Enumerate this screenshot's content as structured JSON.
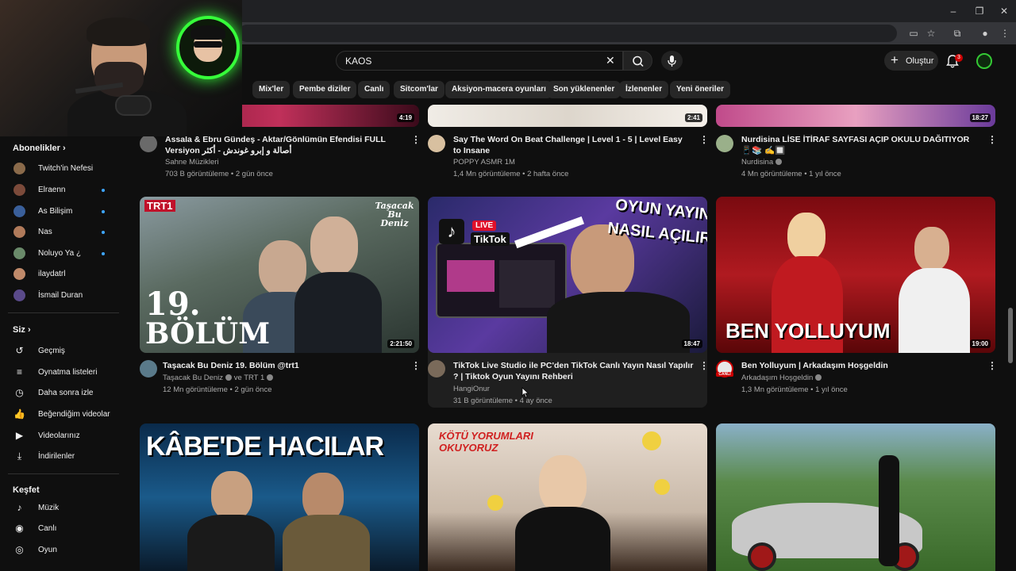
{
  "browser": {
    "window_controls": [
      "–",
      "❐",
      "✕"
    ]
  },
  "search": {
    "query": "KAOS"
  },
  "header": {
    "create_label": "Oluştur",
    "notification_count": "3"
  },
  "chips": [
    "Mix'ler",
    "Pembe diziler",
    "Canlı",
    "Sitcom'lar",
    "Aksiyon-macera oyunları",
    "Son yüklenenler",
    "İzlenenler",
    "Yeni öneriler"
  ],
  "sidebar": {
    "subscriptions_title": "Abonelikler",
    "subscriptions": [
      {
        "label": "Twitch'in Nefesi",
        "color": "#8a6a4a",
        "live": false
      },
      {
        "label": "Elraenn",
        "color": "#7b4a3a",
        "live": true
      },
      {
        "label": "As Bilişim",
        "color": "#3a5f9a",
        "live": true
      },
      {
        "label": "Nas",
        "color": "#b07a5a",
        "live": true
      },
      {
        "label": "Noluyo Ya ¿",
        "color": "#6a8a6a",
        "live": true
      },
      {
        "label": "ilaydatrl",
        "color": "#c08a6a",
        "live": false
      },
      {
        "label": "İsmail Duran",
        "color": "#5a4a8a",
        "live": false
      }
    ],
    "you_title": "Siz",
    "you_items": [
      {
        "label": "Geçmiş",
        "icon": "history-icon",
        "glyph": "↺"
      },
      {
        "label": "Oynatma listeleri",
        "icon": "playlists-icon",
        "glyph": "≡"
      },
      {
        "label": "Daha sonra izle",
        "icon": "watch-later-icon",
        "glyph": "◷"
      },
      {
        "label": "Beğendiğim videolar",
        "icon": "like-icon",
        "glyph": "👍"
      },
      {
        "label": "Videolarınız",
        "icon": "your-videos-icon",
        "glyph": "▶"
      },
      {
        "label": "İndirilenler",
        "icon": "download-icon",
        "glyph": "⤓"
      }
    ],
    "explore_title": "Keşfet",
    "explore_items": [
      {
        "label": "Müzik",
        "icon": "music-icon",
        "glyph": "♪"
      },
      {
        "label": "Canlı",
        "icon": "live-icon",
        "glyph": "◉"
      },
      {
        "label": "Oyun",
        "icon": "gaming-icon",
        "glyph": "◎"
      }
    ]
  },
  "videos_row1": [
    {
      "title": "Assala & Ebru Gündeş - Aktar/Gönlümün Efendisi FULL Versiyon أصالة و إبرو غوندش - أكثر",
      "channel": "Sahne Müzikleri",
      "meta": "703 B görüntüleme • 2 gün önce",
      "duration": "4:19",
      "avatar_color": "#6a6a6a"
    },
    {
      "title": "Say The Word On Beat Challenge | Level 1 - 5 | Level Easy to Insane",
      "channel": "POPPY ASMR 1M",
      "meta": "1,4 Mn görüntüleme • 2 hafta önce",
      "duration": "2:41",
      "avatar_color": "#d8c0a0"
    },
    {
      "title": "Nurdisina LİSE İTİRAF SAYFASI AÇIP OKULU DAĞITIYOR 📱📚 ✍️🔲",
      "channel": "Nurdisina",
      "meta": "4 Mn görüntüleme • 1 yıl önce",
      "duration": "18:27",
      "avatar_color": "#9ab08a"
    }
  ],
  "videos_row2": [
    {
      "title": "Taşacak Bu Deniz 19. Bölüm @trt1",
      "channel": "Taşacak Bu Deniz",
      "channel_extra": "ve TRT 1",
      "meta": "12 Mn görüntüleme • 2 gün önce",
      "duration": "2:21:50",
      "avatar_color": "#5a7a8a",
      "overlay_big": "19.",
      "overlay_word": "BÖLÜM",
      "overlay_brand": "TRT1",
      "overlay_logo": "Taşacak Bu Deniz"
    },
    {
      "title": "TikTok Live Studio ile PC'den TikTok Canlı Yayın Nasıl Yapılır ? | Tiktok Oyun Yayını Rehberi",
      "channel": "HangiOnur",
      "meta": "31 B görüntüleme • 4 ay önce",
      "duration": "18:47",
      "avatar_color": "#7a6a5a",
      "overlay_line1": "OYUN YAYINI",
      "overlay_line2": "NASIL AÇILIR?",
      "overlay_live": "LIVE",
      "overlay_tiktok": "TikTok"
    },
    {
      "title": "Ben Yolluyum | Arkadaşım Hoşgeldin",
      "channel": "Arkadaşım Hoşgeldin",
      "meta": "1,3 Mn görüntüleme • 1 yıl önce",
      "duration": "19:00",
      "avatar_color": "#e8e8e8",
      "overlay_text": "BEN YOLLUYUM",
      "avatar_badge": "CANLI"
    }
  ],
  "videos_row3": [
    {
      "overlay_text": "KÂBE'DE HACILAR"
    },
    {
      "overlay_text": "KÖTÜ YORUMLARI OKUYORUZ"
    },
    {}
  ]
}
